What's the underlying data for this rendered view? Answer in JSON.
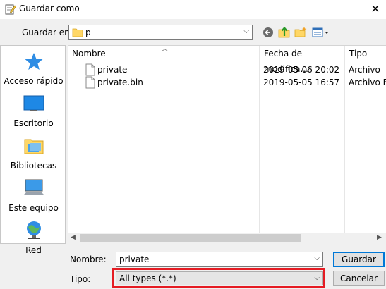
{
  "window": {
    "title": "Guardar como",
    "close_glyph": "✕"
  },
  "toolbar": {
    "save_in_label": "Guardar en:",
    "current_folder": "p",
    "buttons": [
      "back-icon",
      "up-folder-icon",
      "new-folder-icon",
      "view-menu-icon"
    ]
  },
  "places": [
    {
      "label": "Acceso rápido",
      "icon": "star-icon"
    },
    {
      "label": "Escritorio",
      "icon": "desktop-icon"
    },
    {
      "label": "Bibliotecas",
      "icon": "libraries-icon"
    },
    {
      "label": "Este equipo",
      "icon": "computer-icon"
    },
    {
      "label": "Red",
      "icon": "network-icon"
    }
  ],
  "filelist": {
    "columns": [
      "Nombre",
      "Fecha de modifica...",
      "Tipo"
    ],
    "rows": [
      {
        "name": "private",
        "date": "2019-05-06 20:02",
        "type": "Archivo"
      },
      {
        "name": "private.bin",
        "date": "2019-05-05 16:57",
        "type": "Archivo B"
      }
    ]
  },
  "form": {
    "name_label": "Nombre:",
    "name_value": "private",
    "type_label": "Tipo:",
    "type_value": "All types (*.*)"
  },
  "buttons": {
    "save": "Guardar",
    "cancel": "Cancelar"
  },
  "colors": {
    "highlight": "#e51c23",
    "accent": "#0078d7"
  }
}
